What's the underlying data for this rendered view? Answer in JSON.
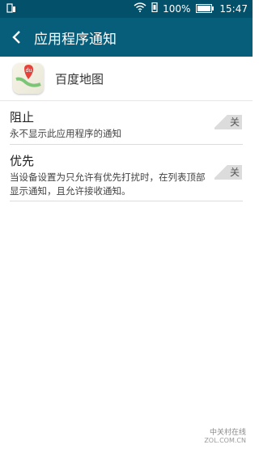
{
  "statusbar": {
    "battery_percent": "100%",
    "time": "15:47",
    "battery_level": 1.0
  },
  "header": {
    "title": "应用程序通知"
  },
  "app": {
    "name": "百度地图",
    "icon_label": "du"
  },
  "settings": [
    {
      "title": "阻止",
      "description": "永不显示此应用程序的通知",
      "toggle": "关"
    },
    {
      "title": "优先",
      "description": "当设备设置为只允许有优先打扰时，在列表顶部显示通知，且允许接收通知。",
      "toggle": "关"
    }
  ],
  "watermark": {
    "line1": "中关村在线",
    "line2": "ZOL.COM.CN"
  }
}
